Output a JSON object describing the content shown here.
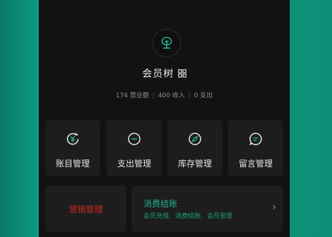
{
  "app": {
    "name": "会员树",
    "title_icon": "grid-icon",
    "logo_icon": "tree-icon"
  },
  "stats": {
    "revenue": "174 营业额",
    "income": "400 收入",
    "expense": "0 支出"
  },
  "menu": [
    {
      "label": "账目管理",
      "icon": "yen-refresh-icon"
    },
    {
      "label": "支出管理",
      "icon": "minus-circle-icon"
    },
    {
      "label": "库存管理",
      "icon": "compass-icon"
    },
    {
      "label": "留言管理",
      "icon": "chat-bubble-icon"
    }
  ],
  "cards": {
    "marketing": {
      "label": "营销管理"
    },
    "checkout": {
      "title": "消费结账",
      "subtitle": "会员充值、消费结账、会员管理",
      "chevron": "›"
    }
  },
  "colors": {
    "accent": "#21b08b",
    "danger": "#d02626",
    "background": "#121212",
    "tile": "#1d1d1d",
    "outer": "#0d8f78"
  }
}
